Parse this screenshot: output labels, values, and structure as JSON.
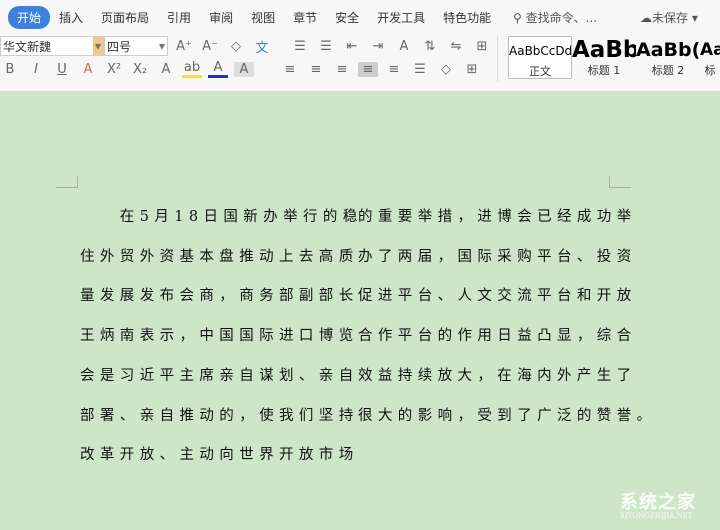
{
  "ribbon": {
    "tabs": [
      "开始",
      "插入",
      "页面布局",
      "引用",
      "审阅",
      "视图",
      "章节",
      "安全",
      "开发工具",
      "特色功能"
    ],
    "search_placeholder": "查找命令、...",
    "save_status": "未保存",
    "font_name": "华文新魏",
    "font_size": "四号",
    "styles": [
      {
        "preview": "AaBbCcDd",
        "name": "正文"
      },
      {
        "preview": "AaBb",
        "name": "标题 1"
      },
      {
        "preview": "AaBb(",
        "name": "标题 2"
      },
      {
        "preview": "Aa",
        "name": "标"
      }
    ]
  },
  "document": {
    "left_column": [
      "　　在5月18日国新办举行的稳",
      "住外贸外资基本盘推动上去高质",
      "量发展发布会商，商务部副部长",
      "王炳南表示，中国国际进口博览",
      "会是习近平主席亲自谋划、亲自",
      "部署、亲自推动的，使我们坚持",
      "改革开放、主动向世界开放市场"
    ],
    "right_column": [
      "的重要举措，进博会已经成功举",
      "办了两届，国际采购平台、投资",
      "促进平台、人文交流平台和开放",
      "合作平台的作用日益凸显，综合",
      "效益持续放大，在海内外产生了",
      "很大的影响，受到了广泛的赞誉。"
    ]
  },
  "watermark": {
    "name": "系统之家",
    "url": "XITONGZHIJIA.NET"
  }
}
